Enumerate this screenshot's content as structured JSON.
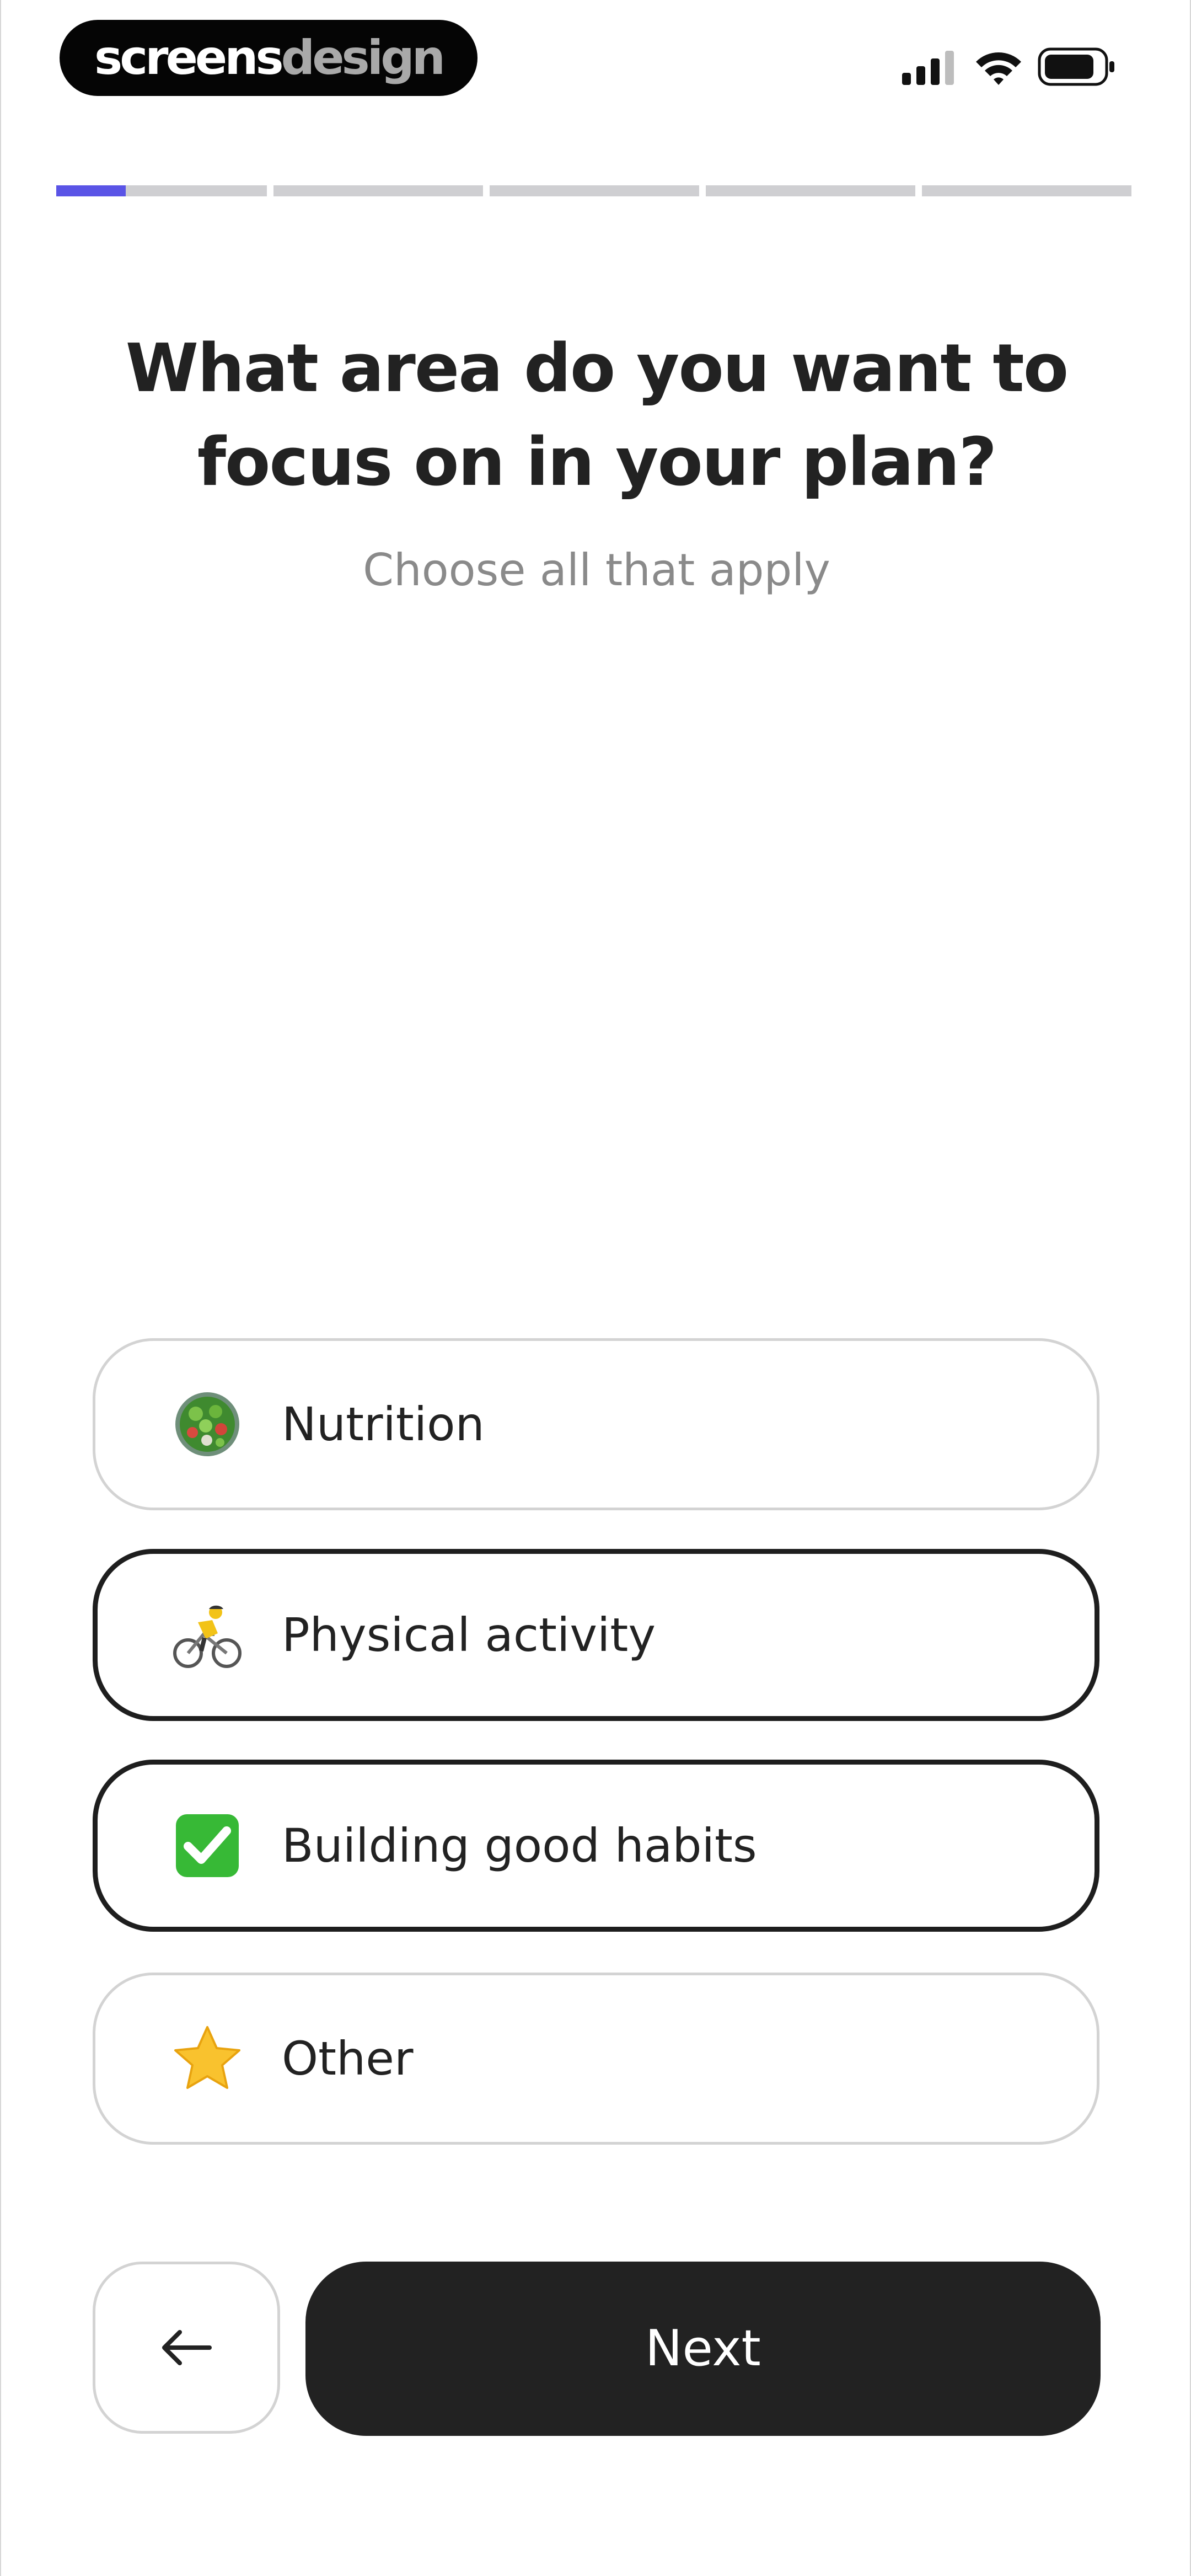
{
  "status_bar": {
    "brand_part1": "screens",
    "brand_part2": "design",
    "icons": [
      "cellular-signal-icon",
      "wifi-icon",
      "battery-icon"
    ]
  },
  "progress": {
    "current_step": 1,
    "total_steps": 6,
    "current_step_fraction": 0.33,
    "active_color": "#5a54e6",
    "inactive_color": "#cfcfd2"
  },
  "question": {
    "title": "What area do you want to focus on in your plan?",
    "subtitle": "Choose all that apply"
  },
  "options": [
    {
      "label": "Nutrition",
      "icon": "salad-bowl-icon",
      "selected": false
    },
    {
      "label": "Physical activity",
      "icon": "cyclist-icon",
      "selected": true
    },
    {
      "label": "Building good habits",
      "icon": "check-mark-button-icon",
      "selected": true
    },
    {
      "label": "Other",
      "icon": "star-icon",
      "selected": false
    }
  ],
  "footer": {
    "back_icon": "arrow-left-icon",
    "next_label": "Next"
  },
  "colors": {
    "text_primary": "#222222",
    "text_secondary": "#8a8a8a",
    "selected_border": "#1e1e1e",
    "unselected_border": "#d3d3d3",
    "button_dark": "#222222"
  }
}
